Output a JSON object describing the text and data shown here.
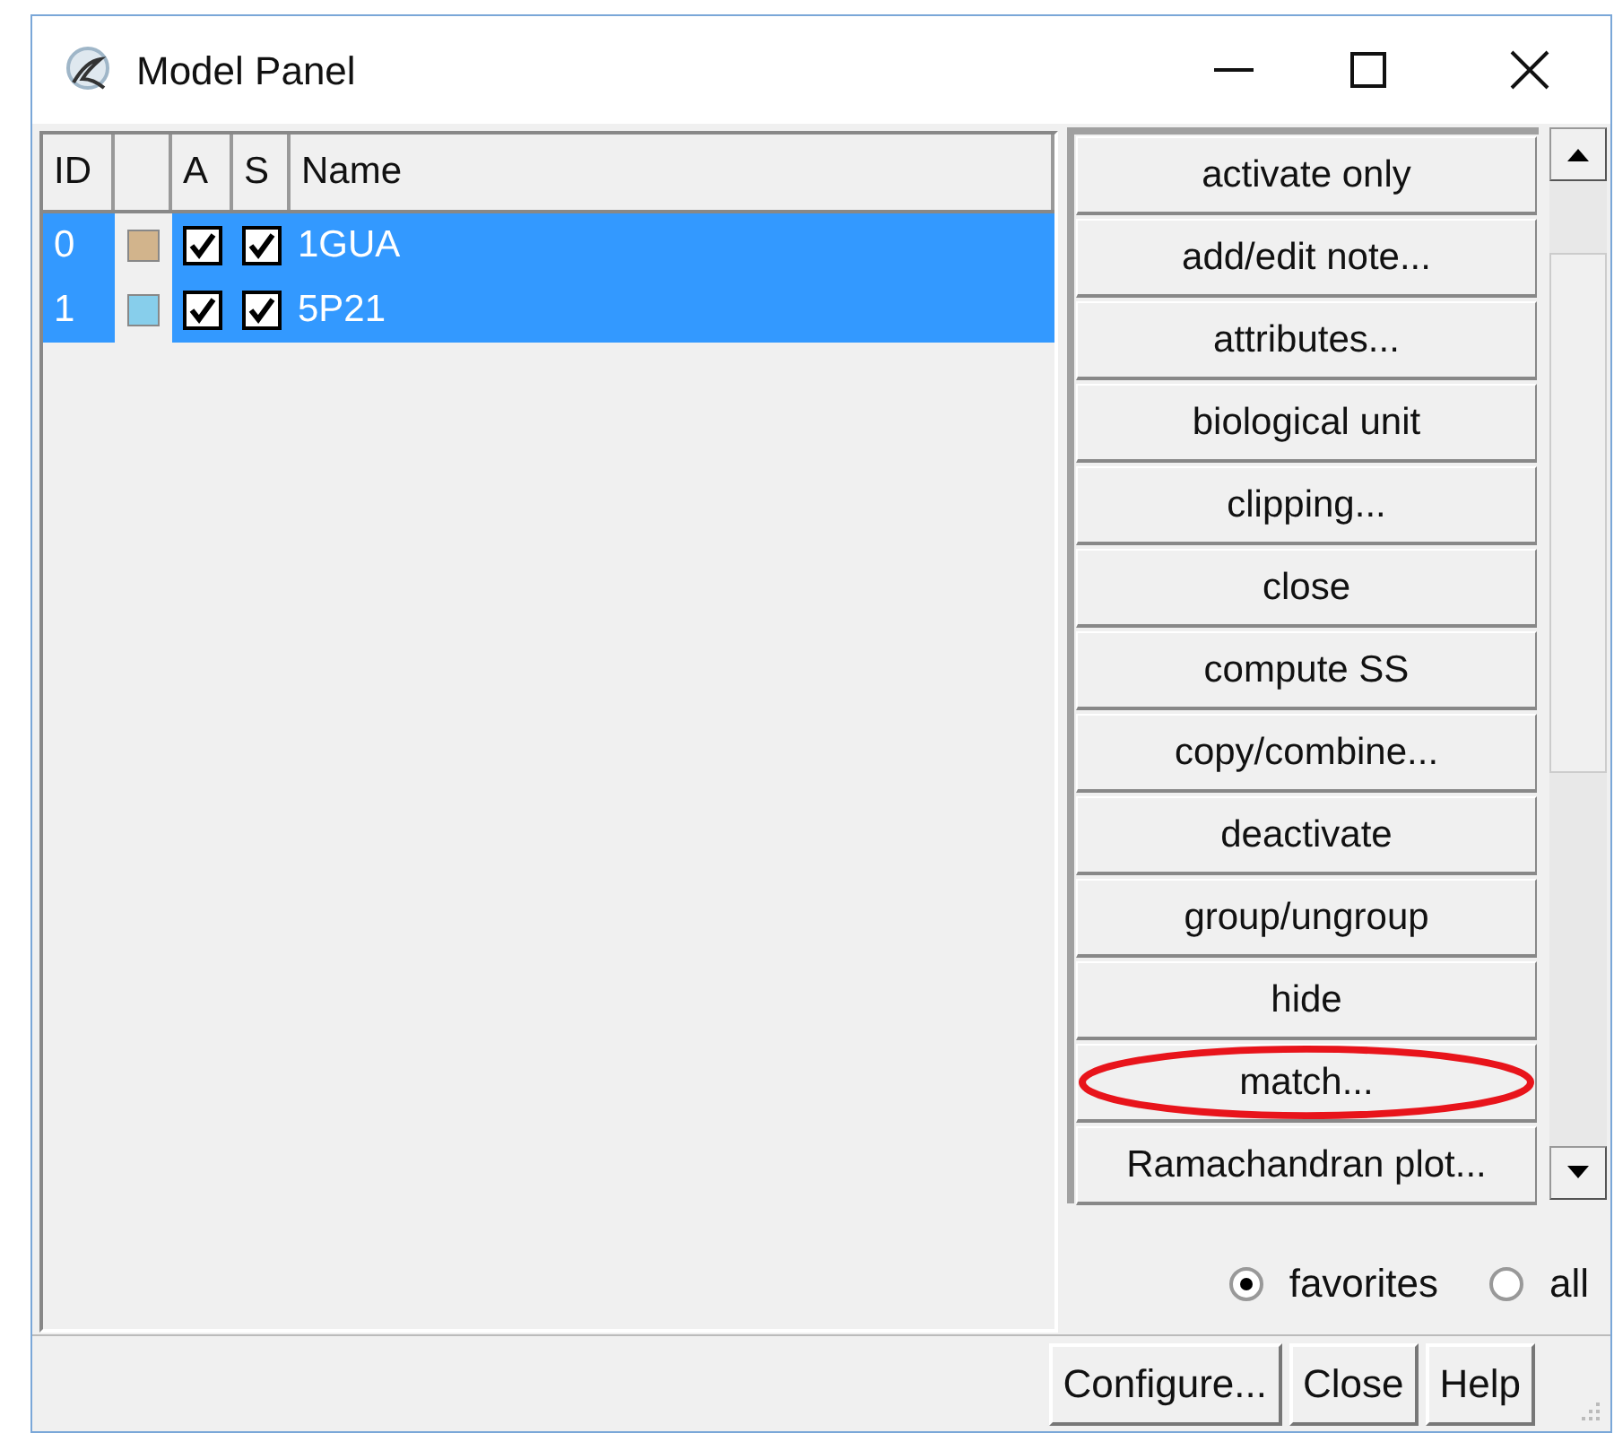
{
  "window": {
    "title": "Model Panel"
  },
  "table": {
    "columns": [
      "ID",
      "",
      "A",
      "S",
      "Name"
    ],
    "rows": [
      {
        "id": "0",
        "color": "#d2b48c",
        "active": true,
        "shown": true,
        "name": "1GUA",
        "selected": true
      },
      {
        "id": "1",
        "color": "#87ceeb",
        "active": true,
        "shown": true,
        "name": "5P21",
        "selected": true
      }
    ]
  },
  "actions": [
    {
      "label": "activate only",
      "highlighted": false
    },
    {
      "label": "add/edit note...",
      "highlighted": false
    },
    {
      "label": "attributes...",
      "highlighted": false
    },
    {
      "label": "biological unit",
      "highlighted": false
    },
    {
      "label": "clipping...",
      "highlighted": false
    },
    {
      "label": "close",
      "highlighted": false
    },
    {
      "label": "compute SS",
      "highlighted": false
    },
    {
      "label": "copy/combine...",
      "highlighted": false
    },
    {
      "label": "deactivate",
      "highlighted": false
    },
    {
      "label": "group/ungroup",
      "highlighted": false
    },
    {
      "label": "hide",
      "highlighted": false
    },
    {
      "label": "match...",
      "highlighted": true
    },
    {
      "label": "Ramachandran plot...",
      "highlighted": false
    }
  ],
  "filter": [
    {
      "label": "favorites",
      "selected": true
    },
    {
      "label": "all",
      "selected": false
    }
  ],
  "footer_buttons": [
    "Configure...",
    "Close",
    "Help"
  ]
}
